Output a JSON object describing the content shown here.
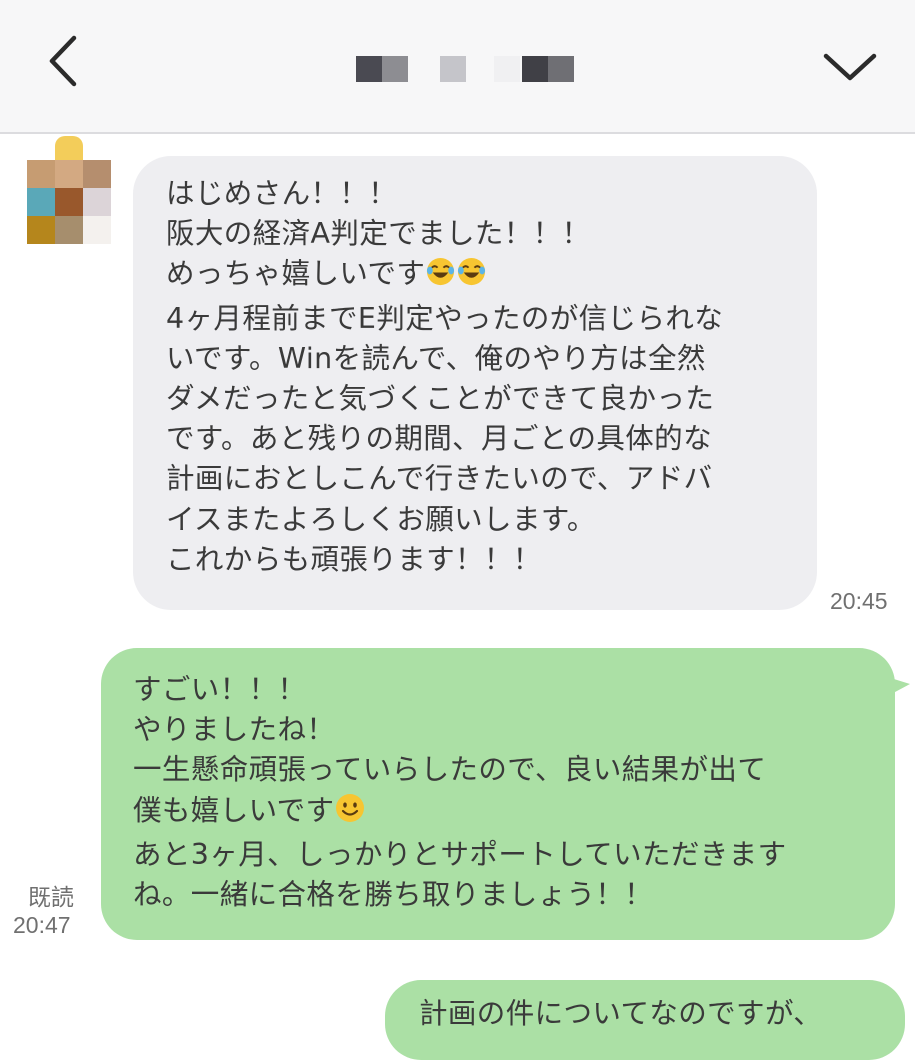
{
  "header": {
    "back_icon": "chevron-left-icon",
    "menu_icon": "chevron-down-icon"
  },
  "messages": [
    {
      "direction": "incoming",
      "lines": [
        "はじめさん！！！",
        "阪大の経済A判定でました！！！",
        "めっちゃ嬉しいです",
        "4ヶ月程前までE判定やったのが信じられな",
        "いです。Winを読んで、俺のやり方は全然",
        "ダメだったと気づくことができて良かった",
        "です。あと残りの期間、月ごとの具体的な",
        "計画におとしこんで行きたいので、アドバ",
        "イスまたよろしくお願いします。",
        "これからも頑張ります！！！"
      ],
      "emoji": "face-with-tears-of-joy-icon",
      "time": "20:45"
    },
    {
      "direction": "outgoing",
      "lines": [
        "すごい！！！",
        "やりましたね！",
        "一生懸命頑張っていらしたので、良い結果が出て",
        "僕も嬉しいです",
        "あと3ヶ月、しっかりとサポートしていただきます",
        "ね。一緒に合格を勝ち取りましょう！！"
      ],
      "emoji": "smiling-face-icon",
      "read_label": "既読",
      "time": "20:47"
    },
    {
      "direction": "outgoing",
      "lines": [
        "計画の件についてなのですが、"
      ]
    }
  ],
  "colors": {
    "incoming_bubble": "#eeeef1",
    "outgoing_bubble": "#abe0a5",
    "header_bg": "#f7f7f8"
  }
}
